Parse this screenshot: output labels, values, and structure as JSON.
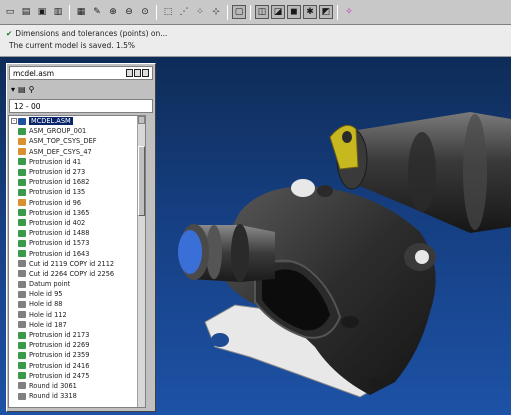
{
  "toolbar": {
    "buttons": [
      {
        "icon": "new-file-icon",
        "glyph": "▭"
      },
      {
        "icon": "open-file-icon",
        "glyph": "▤"
      },
      {
        "icon": "save-icon",
        "glyph": "▣"
      },
      {
        "icon": "print-icon",
        "glyph": "▥"
      },
      {
        "icon": "sep"
      },
      {
        "icon": "window-icon",
        "glyph": "▦"
      },
      {
        "icon": "redraw-icon",
        "glyph": "✎"
      },
      {
        "icon": "zoom-in-icon",
        "glyph": "⊕"
      },
      {
        "icon": "zoom-out-icon",
        "glyph": "⊖"
      },
      {
        "icon": "refit-icon",
        "glyph": "⊙"
      },
      {
        "icon": "sep"
      },
      {
        "icon": "datum-plane-icon",
        "glyph": "⬚"
      },
      {
        "icon": "datum-axis-icon",
        "glyph": "⋰"
      },
      {
        "icon": "datum-point-icon",
        "glyph": "⁘"
      },
      {
        "icon": "coordinate-system-icon",
        "glyph": "⊹"
      },
      {
        "icon": "sep"
      },
      {
        "icon": "wireframe-icon",
        "glyph": "▢",
        "pressed": true
      },
      {
        "icon": "sep"
      },
      {
        "icon": "hidden-line-icon",
        "glyph": "◫",
        "pressed": true
      },
      {
        "icon": "no-hidden-icon",
        "glyph": "◪",
        "pressed": true
      },
      {
        "icon": "shading-icon",
        "glyph": "◼",
        "pressed": true
      },
      {
        "icon": "spin-center-icon",
        "glyph": "✱",
        "pressed": true
      },
      {
        "icon": "model-tree-icon",
        "glyph": "◩",
        "pressed": true
      },
      {
        "icon": "sep"
      },
      {
        "icon": "highlight-icon",
        "glyph": "✧",
        "magenta": true
      }
    ]
  },
  "messages": [
    "Dimensions and tolerances (points) on...",
    "The current model is saved.   1.5%"
  ],
  "tree_panel": {
    "title": "mcdel.asm",
    "filter_text": "12 - 00",
    "rows": [
      {
        "label": "MCDEL.ASM",
        "icon": "root",
        "exp": "-",
        "selected": true
      },
      {
        "label": "ASM_GROUP_001",
        "icon": "green",
        "exp": ""
      },
      {
        "label": "ASM_TOP_CSYS_DEF",
        "icon": "orange",
        "exp": ""
      },
      {
        "label": "ASM_DEF_CSYS_47",
        "icon": "orange",
        "exp": ""
      },
      {
        "label": "Protrusion id 41",
        "icon": "green",
        "exp": ""
      },
      {
        "label": "Protrusion id 273",
        "icon": "green",
        "exp": ""
      },
      {
        "label": "Protrusion id 1682",
        "icon": "green",
        "exp": ""
      },
      {
        "label": "Protrusion id 135",
        "icon": "green",
        "exp": ""
      },
      {
        "label": "Protrusion id 96",
        "icon": "orange",
        "exp": ""
      },
      {
        "label": "Protrusion id 1365",
        "icon": "green",
        "exp": ""
      },
      {
        "label": "Protrusion id 402",
        "icon": "green",
        "exp": ""
      },
      {
        "label": "Protrusion id 1488",
        "icon": "green",
        "exp": ""
      },
      {
        "label": "Protrusion id 1573",
        "icon": "green",
        "exp": ""
      },
      {
        "label": "Protrusion id 1643",
        "icon": "green",
        "exp": ""
      },
      {
        "label": "Cut id 2119 COPY id 2112",
        "icon": "gray",
        "exp": ""
      },
      {
        "label": "Cut id 2264 COPY id 2256",
        "icon": "gray",
        "exp": ""
      },
      {
        "label": "Datum point",
        "icon": "gray",
        "exp": ""
      },
      {
        "label": "Hole id 95",
        "icon": "gray",
        "exp": ""
      },
      {
        "label": "Hole id 88",
        "icon": "gray",
        "exp": ""
      },
      {
        "label": "Hole id 112",
        "icon": "gray",
        "exp": ""
      },
      {
        "label": "Hole id 187",
        "icon": "gray",
        "exp": ""
      },
      {
        "label": "Protrusion id 2173",
        "icon": "green",
        "exp": ""
      },
      {
        "label": "Protrusion id 2269",
        "icon": "green",
        "exp": ""
      },
      {
        "label": "Protrusion id 2359",
        "icon": "green",
        "exp": ""
      },
      {
        "label": "Protrusion id 2416",
        "icon": "green",
        "exp": ""
      },
      {
        "label": "Protrusion id 2475",
        "icon": "green",
        "exp": ""
      },
      {
        "label": "Round id 3061",
        "icon": "gray",
        "exp": ""
      },
      {
        "label": "Round id 3318",
        "icon": "gray",
        "exp": ""
      }
    ]
  },
  "colors": {
    "viewport_top": "#0e2c58",
    "viewport_bottom": "#1d52a6",
    "part_dark": "#2a2a2a",
    "part_light": "#6a6a6a",
    "bore_face": "#3a6fd8",
    "lug": "#c8b820",
    "flange_plate": "#e6e6e6"
  }
}
